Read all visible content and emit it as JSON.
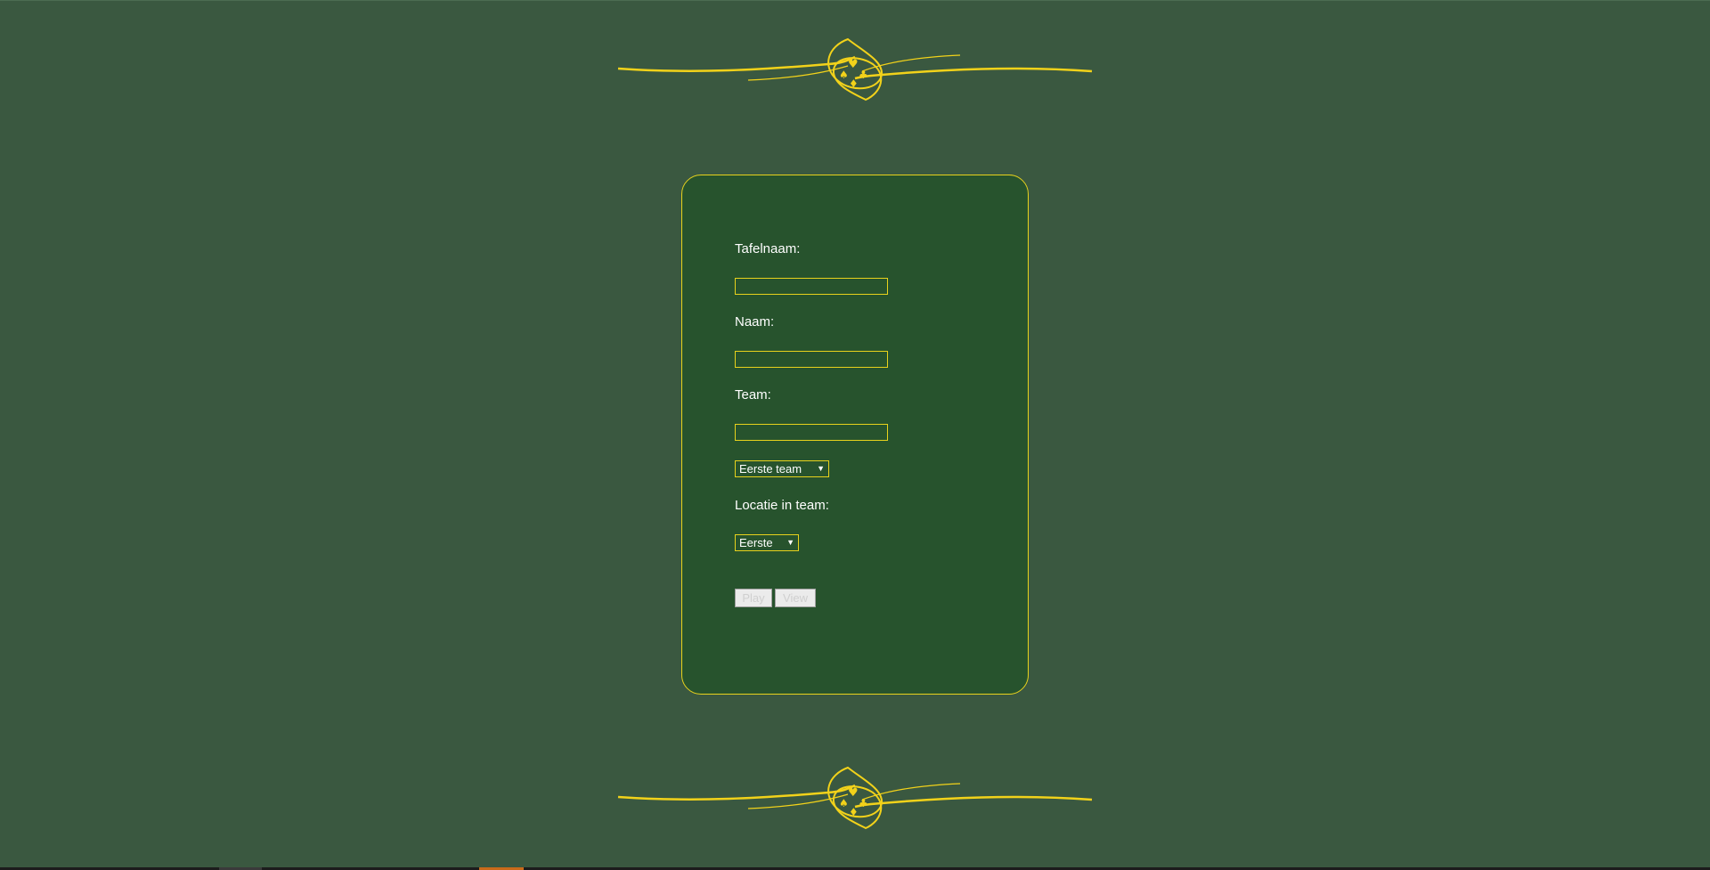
{
  "colors": {
    "background": "#3a5840",
    "panel": "#27532d",
    "accent_gold": "#e8d21c",
    "text": "#ffffff"
  },
  "decorations": {
    "top_ornament": "card-suits-flourish-icon",
    "bottom_ornament": "card-suits-flourish-icon"
  },
  "form": {
    "tafelnaam_label": "Tafelnaam:",
    "tafelnaam_value": "",
    "naam_label": "Naam:",
    "naam_value": "",
    "team_label": "Team:",
    "team_value": "",
    "team_select_value": "Eerste team",
    "locatie_label": "Locatie in team:",
    "locatie_select_value": "Eerste",
    "play_label": "Play",
    "view_label": "View"
  }
}
